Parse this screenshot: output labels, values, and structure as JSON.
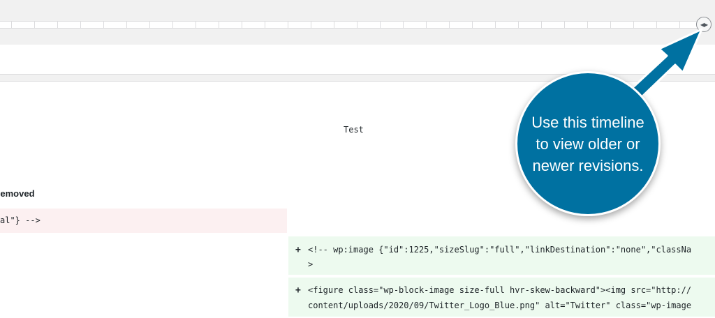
{
  "timeline": {
    "handle_icon": "left-right-arrows-icon",
    "handle_glyph": "◀▶"
  },
  "diff": {
    "title": "Test",
    "removed_label": "Removed",
    "removed_line": "al\"} -->",
    "added": [
      {
        "plus": "+",
        "lines": [
          "<!-- wp:image {\"id\":1225,\"sizeSlug\":\"full\",\"linkDestination\":\"none\",\"classNa",
          ">"
        ]
      },
      {
        "plus": "+",
        "lines": [
          "<figure class=\"wp-block-image size-full hvr-skew-backward\"><img src=\"http://",
          "content/uploads/2020/09/Twitter_Logo_Blue.png\" alt=\"Twitter\" class=\"wp-image"
        ]
      }
    ]
  },
  "callout": {
    "lines": [
      "Use this timeline",
      "to view older or",
      "newer revisions."
    ],
    "color": "#0071a1"
  }
}
